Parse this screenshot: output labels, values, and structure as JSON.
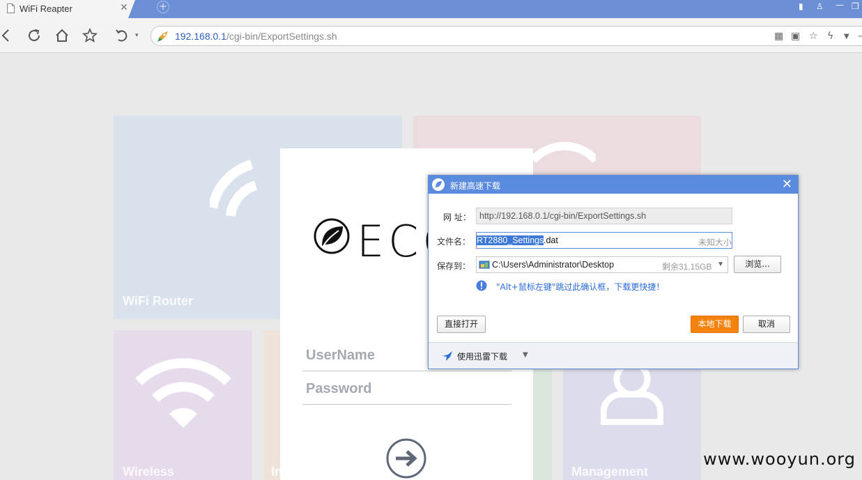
{
  "browser": {
    "tab_title": "WiFi Reapter",
    "url_host": "192.168.0.1",
    "url_path": "/cgi-bin/ExportSettings.sh"
  },
  "page": {
    "logo_text": "ECO",
    "tiles": {
      "wifi_router": "WiFi Router",
      "wireless": "Wireless",
      "internet_partial": "In",
      "management": "Management"
    },
    "login": {
      "username_placeholder": "UserName",
      "password_placeholder": "Password"
    },
    "watermark": "www.wooyun.org"
  },
  "dialog": {
    "title": "新建高速下载",
    "url_label": "网 址：",
    "url_value": "http://192.168.0.1/cgi-bin/ExportSettings.sh",
    "filename_label": "文件名：",
    "filename_selected": "RT2880_Settings",
    "filename_ext": ".dat",
    "filesize": "未知大小",
    "saveto_label": "保存到：",
    "saveto_path": "C:\\Users\\Administrator\\Desktop",
    "free_space": "剩余31.15GB",
    "browse_label": "浏览...",
    "hint": "\"Alt+鼠标左键\"跳过此确认框，下载更快捷！",
    "open_direct_label": "直接打开",
    "local_download_label": "本地下载",
    "cancel_label": "取消",
    "xunlei_label": "使用迅雷下载"
  },
  "colors": {
    "tabbar": "#6b8fd4",
    "dialog_title": "#5b8bdf",
    "primary_button": "#f5820a",
    "selection": "#3c78d8",
    "hint_text": "#2a6bd8"
  }
}
